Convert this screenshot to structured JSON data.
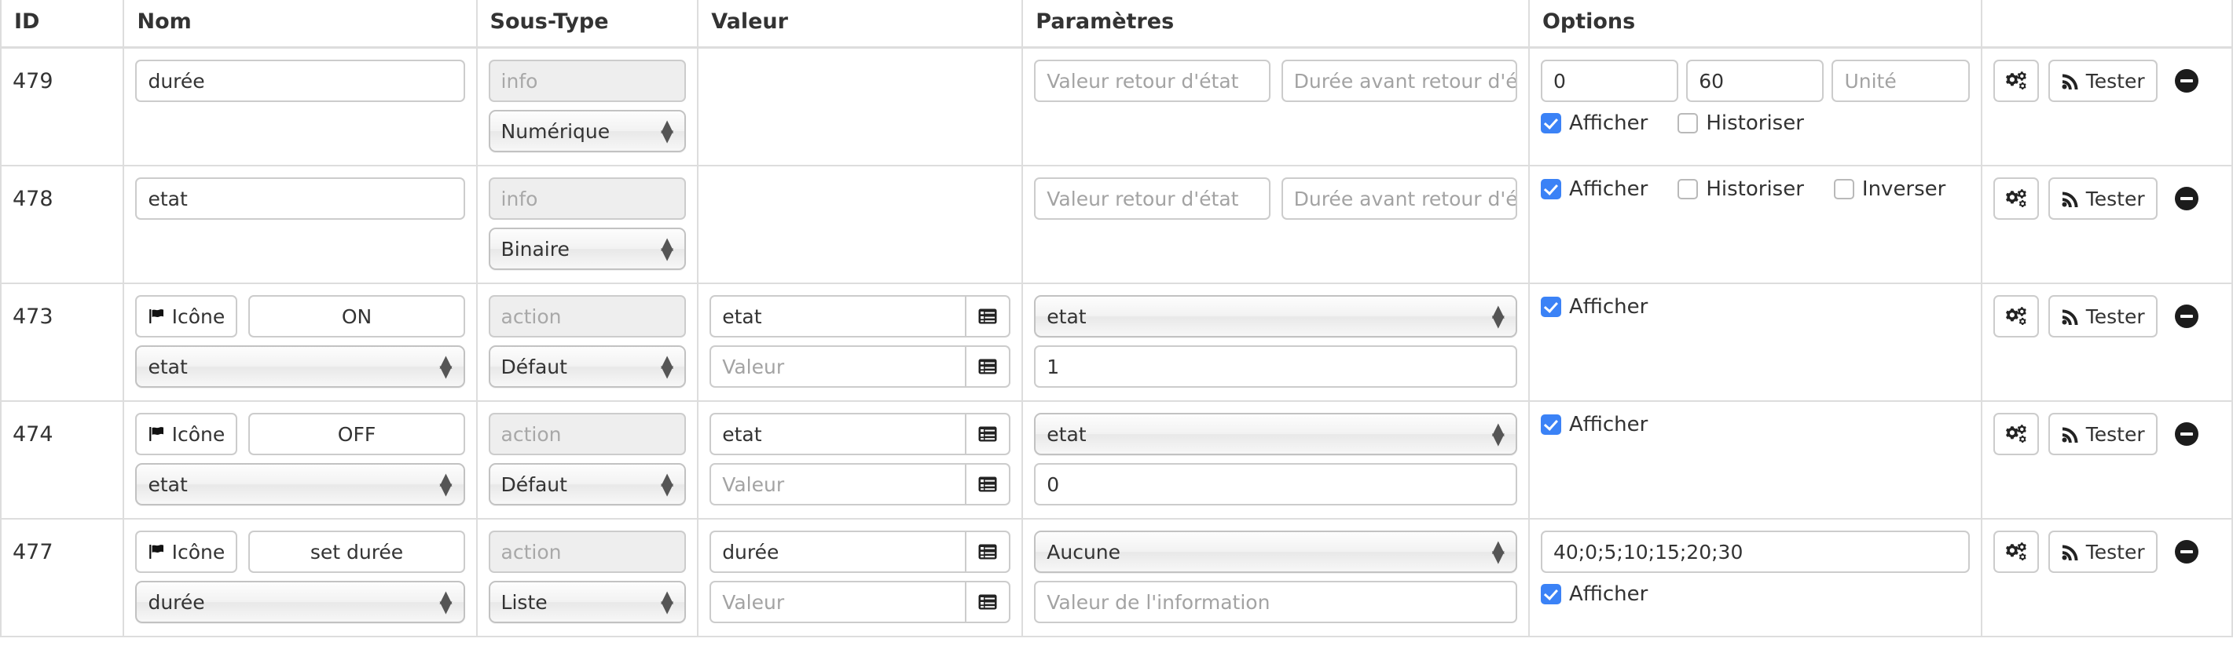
{
  "table": {
    "headers": [
      "ID",
      "Nom",
      "Sous-Type",
      "Valeur",
      "Paramètres",
      "Options",
      ""
    ],
    "icon_button_label": "Icône",
    "test_button_label": "Tester",
    "placeholders": {
      "info": "info",
      "action": "action",
      "valeur_retour_etat": "Valeur retour d'état",
      "duree_avant_retour": "Durée avant retour d'éta",
      "unite": "Unité",
      "valeur": "Valeur",
      "valeur_information": "Valeur de l'information"
    },
    "checkbox_labels": {
      "afficher": "Afficher",
      "historiser": "Historiser",
      "inverser": "Inverser"
    },
    "accent_color": "#3b82f6",
    "rows": [
      {
        "id": "479",
        "kind": "info",
        "name": "durée",
        "type_badge": "info",
        "subtype_select": "Numérique",
        "valeur": null,
        "param_a": "",
        "param_a_ph": "Valeur retour d'état",
        "param_b": "",
        "param_b_ph": "Durée avant retour d'éta",
        "opt_min": "0",
        "opt_max": "60",
        "opt_unit": "",
        "opt_unit_ph": "Unité",
        "afficher": true,
        "historiser": false,
        "inverser": null
      },
      {
        "id": "478",
        "kind": "info",
        "name": "etat",
        "type_badge": "info",
        "subtype_select": "Binaire",
        "valeur": null,
        "param_a": "",
        "param_a_ph": "Valeur retour d'état",
        "param_b": "",
        "param_b_ph": "Durée avant retour d'éta",
        "afficher": true,
        "historiser": false,
        "inverser": false
      },
      {
        "id": "473",
        "kind": "action",
        "icon_label": "Icône",
        "name": "ON",
        "name_select": "etat",
        "type_badge": "action",
        "subtype_select": "Défaut",
        "valeur_top": "etat",
        "valeur_bottom": "",
        "valeur_bottom_ph": "Valeur",
        "param_select": "etat",
        "param_value": "1",
        "afficher": true
      },
      {
        "id": "474",
        "kind": "action",
        "icon_label": "Icône",
        "name": "OFF",
        "name_select": "etat",
        "type_badge": "action",
        "subtype_select": "Défaut",
        "valeur_top": "etat",
        "valeur_bottom": "",
        "valeur_bottom_ph": "Valeur",
        "param_select": "etat",
        "param_value": "0",
        "afficher": true
      },
      {
        "id": "477",
        "kind": "action",
        "icon_label": "Icône",
        "name": "set durée",
        "name_select": "durée",
        "type_badge": "action",
        "subtype_select": "Liste",
        "valeur_top": "durée",
        "valeur_bottom": "",
        "valeur_bottom_ph": "Valeur",
        "param_select": "Aucune",
        "param_value": "",
        "param_value_ph": "Valeur de l'information",
        "option_list": "40;0;5;10;15;20;30",
        "afficher": true
      }
    ]
  }
}
